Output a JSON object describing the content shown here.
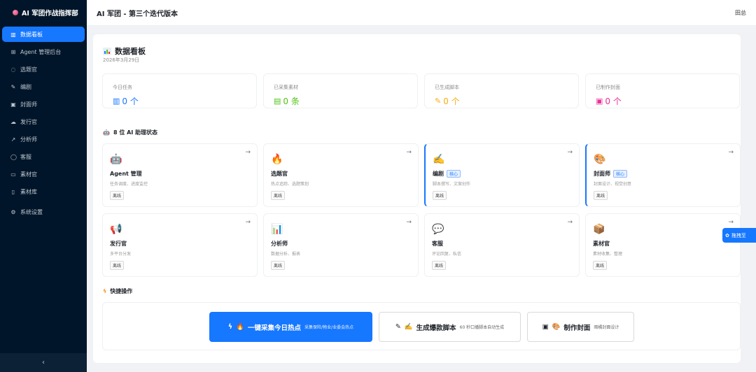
{
  "app": {
    "brand": "AI 军团作战指挥部",
    "header_title": "AI 军团 - 第三个迭代版本",
    "user": "田总"
  },
  "sidebar": {
    "items": [
      {
        "label": "数据看板",
        "icon": "bar-chart-icon",
        "active": true
      },
      {
        "label": "Agent 管理后台",
        "icon": "grid-icon"
      },
      {
        "label": "选题官",
        "icon": "fire-icon"
      },
      {
        "label": "编剧",
        "icon": "edit-icon"
      },
      {
        "label": "封面师",
        "icon": "image-icon"
      },
      {
        "label": "发行官",
        "icon": "cloud-icon"
      },
      {
        "label": "分析师",
        "icon": "line-chart-icon"
      },
      {
        "label": "客服",
        "icon": "message-icon"
      },
      {
        "label": "素材官",
        "icon": "folder-icon"
      },
      {
        "label": "素材库",
        "icon": "file-icon"
      },
      {
        "label": "系统设置",
        "icon": "gear-icon"
      }
    ],
    "collapse": "‹"
  },
  "page": {
    "title": "数据看板",
    "date": "2026年3月29日"
  },
  "stats": [
    {
      "label": "今日任务",
      "value": "0 个",
      "icon": "bar-chart-icon",
      "color": "#1677ff"
    },
    {
      "label": "已采集素材",
      "value": "0 条",
      "icon": "file-icon",
      "color": "#52c41a"
    },
    {
      "label": "已生成脚本",
      "value": "0 个",
      "icon": "edit-icon",
      "color": "#faad14"
    },
    {
      "label": "已制作封面",
      "value": "0 个",
      "icon": "image-icon",
      "color": "#eb2f96"
    }
  ],
  "agents_section": {
    "title": "8 位 AI 助理状态"
  },
  "agents": [
    {
      "name": "Agent 管理",
      "desc": "任务调度、进度监控",
      "status": "离线",
      "icon": "robot-icon",
      "emoji": "🤖",
      "core": false
    },
    {
      "name": "选题官",
      "desc": "热点追踪、选题策划",
      "status": "离线",
      "icon": "fire-icon",
      "emoji": "🔥",
      "core": false
    },
    {
      "name": "编剧",
      "desc": "脚本撰写、文案创作",
      "status": "离线",
      "icon": "writing-hand-icon",
      "emoji": "✍️",
      "core": true,
      "tag": "核心"
    },
    {
      "name": "封面师",
      "desc": "封面设计、视觉创意",
      "status": "离线",
      "icon": "palette-icon",
      "emoji": "🎨",
      "core": true,
      "tag": "核心"
    },
    {
      "name": "发行官",
      "desc": "多平台分发",
      "status": "离线",
      "icon": "megaphone-icon",
      "emoji": "📢",
      "core": false
    },
    {
      "name": "分析师",
      "desc": "数据分析、报表",
      "status": "离线",
      "icon": "chart-icon",
      "emoji": "📊",
      "core": false
    },
    {
      "name": "客服",
      "desc": "评论回复、私信",
      "status": "离线",
      "icon": "speech-bubble-icon",
      "emoji": "💬",
      "core": false
    },
    {
      "name": "素材官",
      "desc": "素材收集、整理",
      "status": "离线",
      "icon": "package-icon",
      "emoji": "📦",
      "core": false
    }
  ],
  "quick_section": {
    "title": "快捷操作"
  },
  "quick_actions": [
    {
      "label": "一键采集今日热点",
      "sub": "采集保险/物业/业委会热点",
      "primary": true
    },
    {
      "label": "生成爆款脚本",
      "sub": "60 秒口播脚本自动生成",
      "primary": false
    },
    {
      "label": "制作封面",
      "sub": "暗橘封面设计",
      "primary": false
    }
  ],
  "float_tab": {
    "label": "拖拽至"
  }
}
